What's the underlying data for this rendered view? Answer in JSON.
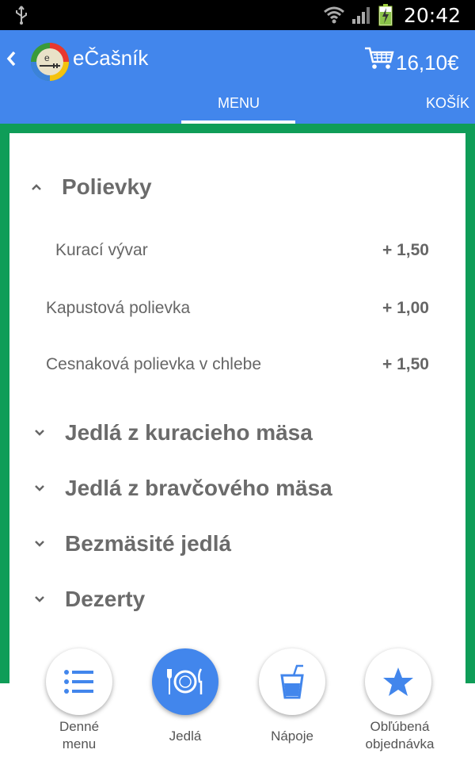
{
  "status_bar": {
    "time": "20:42"
  },
  "app_bar": {
    "title": "eČašník",
    "cart_total": "16,10€",
    "tabs": [
      {
        "label": "MENU",
        "active": true
      },
      {
        "label": "KOŠÍK",
        "active": false
      }
    ]
  },
  "colors": {
    "accent": "#4286ec",
    "frame": "#0f9d58",
    "text": "#666666"
  },
  "menu": {
    "sections": [
      {
        "title": "Polievky",
        "expanded": true,
        "items": [
          {
            "name": "Kurací vývar",
            "price": "+ 1,50"
          },
          {
            "name": "Kapustová polievka",
            "price": "+ 1,00"
          },
          {
            "name": "Cesnaková polievka v chlebe",
            "price": "+ 1,50"
          }
        ]
      },
      {
        "title": "Jedlá z kuracieho mäsa",
        "expanded": false
      },
      {
        "title": "Jedlá z bravčového mäsa",
        "expanded": false
      },
      {
        "title": "Bezmäsité jedlá",
        "expanded": false
      },
      {
        "title": "Dezerty",
        "expanded": false
      }
    ]
  },
  "bottom_nav": [
    {
      "label_line1": "Denné",
      "label_line2": "menu",
      "icon": "list-icon",
      "active": false
    },
    {
      "label_line1": "Jedlá",
      "label_line2": "",
      "icon": "plate-cutlery-icon",
      "active": true
    },
    {
      "label_line1": "Nápoje",
      "label_line2": "",
      "icon": "drink-icon",
      "active": false
    },
    {
      "label_line1": "Obľúbená",
      "label_line2": "objednávka",
      "icon": "star-icon",
      "active": false
    }
  ]
}
